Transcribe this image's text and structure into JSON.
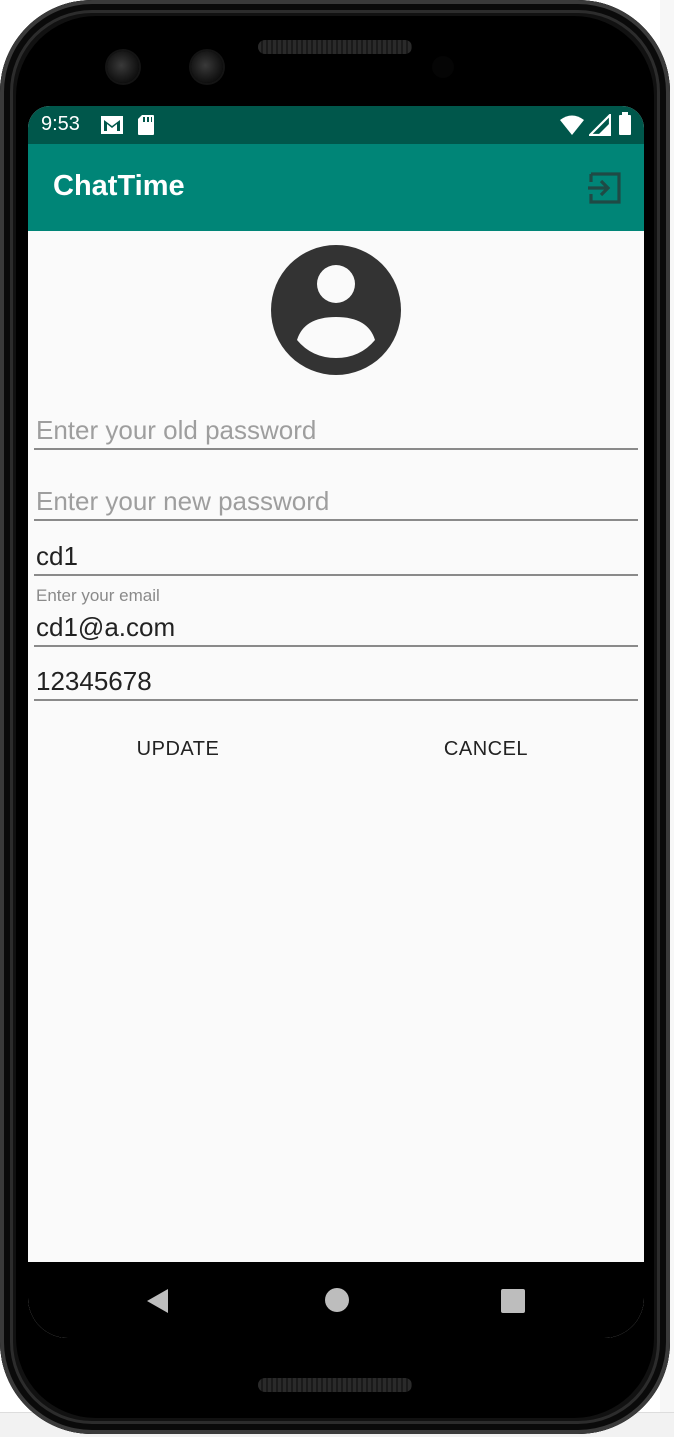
{
  "status": {
    "time": "9:53",
    "icons": [
      "gmail-icon",
      "sd-card-icon",
      "wifi-icon",
      "signal-icon",
      "battery-icon"
    ]
  },
  "appbar": {
    "title": "ChatTime",
    "action_icon": "logout-icon",
    "color": "#008577",
    "status_color": "#00574b"
  },
  "profile": {
    "avatar_icon": "account-circle-icon"
  },
  "form": {
    "old_password": {
      "placeholder": "Enter your old password",
      "value": ""
    },
    "new_password": {
      "placeholder": "Enter your new password",
      "value": ""
    },
    "username": {
      "value": "cd1"
    },
    "email": {
      "label": "Enter your email",
      "value": "cd1@a.com"
    },
    "phone": {
      "value": "12345678"
    }
  },
  "buttons": {
    "update": "UPDATE",
    "cancel": "CANCEL"
  },
  "navbar": {
    "icons": [
      "back-icon",
      "home-icon",
      "recents-icon"
    ]
  }
}
